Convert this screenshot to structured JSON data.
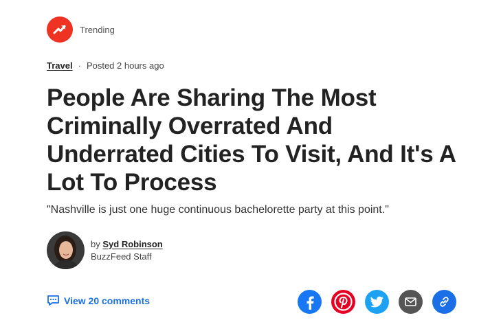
{
  "trending": {
    "label": "Trending",
    "icon": "trending-arrow-icon",
    "color": "#ee3322"
  },
  "meta": {
    "category": "Travel",
    "separator": "·",
    "posted": "Posted 2 hours ago"
  },
  "headline": "People Are Sharing The Most Criminally Overrated And Underrated Cities To Visit, And It's A Lot To Process",
  "dek": "\"Nashville is just one huge continuous bachelorette party at this point.\"",
  "byline": {
    "by": "by",
    "author": "Syd Robinson",
    "role": "BuzzFeed Staff"
  },
  "comments": {
    "label": "View 20 comments",
    "icon": "comment-bubble-icon",
    "color": "#1a6ee6"
  },
  "share": [
    {
      "name": "facebook",
      "icon": "facebook-icon",
      "color": "#1877f2"
    },
    {
      "name": "pinterest",
      "icon": "pinterest-icon",
      "color": "#e60023"
    },
    {
      "name": "twitter",
      "icon": "twitter-icon",
      "color": "#1da1f2"
    },
    {
      "name": "email",
      "icon": "email-icon",
      "color": "#555555"
    },
    {
      "name": "copy-link",
      "icon": "link-icon",
      "color": "#1a6ee6"
    }
  ]
}
